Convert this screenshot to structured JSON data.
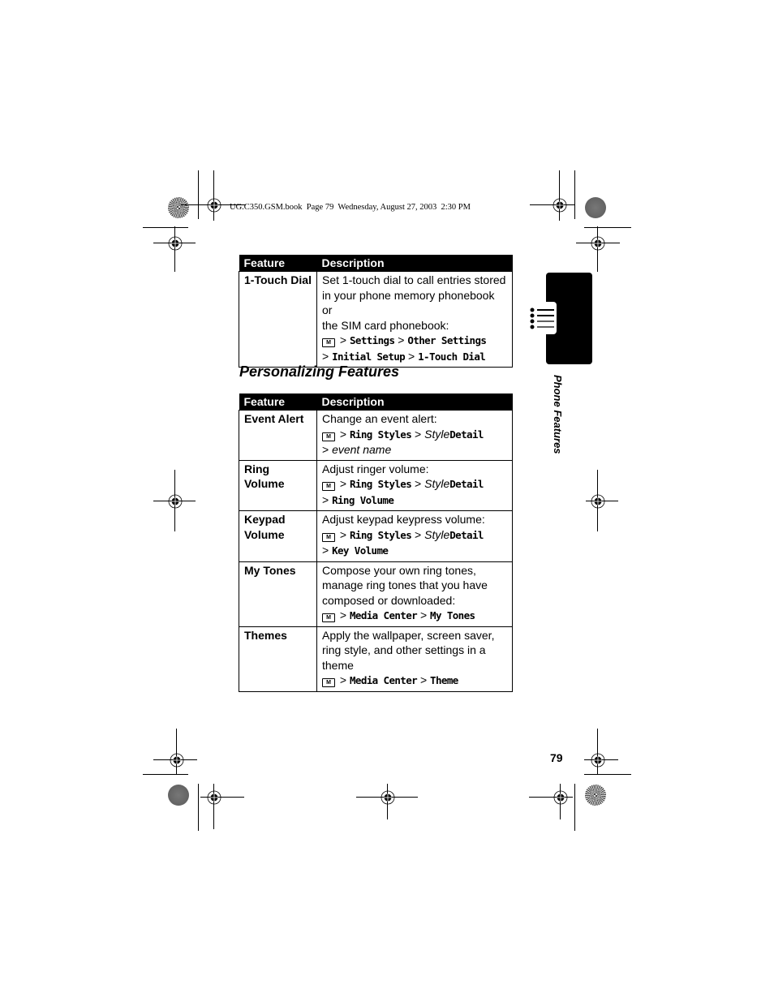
{
  "header": {
    "print_line": "UG.C350.GSM.book  Page 79  Wednesday, August 27, 2003  2:30 PM"
  },
  "side_tab": {
    "label": "Phone Features",
    "icon": "list-bullets-icon"
  },
  "table1": {
    "headers": [
      "Feature",
      "Description"
    ],
    "rows": [
      {
        "feature": "1-Touch Dial",
        "desc_lines": [
          "Set 1-touch dial to call entries stored",
          "in your phone memory phonebook or",
          "the SIM card phonebook:"
        ],
        "path": [
          {
            "text": "Settings",
            "style": "mono"
          },
          {
            "text": "Other Settings",
            "style": "mono"
          },
          {
            "text": "Initial Setup",
            "style": "mono",
            "newline": true
          },
          {
            "text": "1-Touch Dial",
            "style": "mono"
          }
        ]
      }
    ]
  },
  "section": {
    "title": "Personalizing Features"
  },
  "table2": {
    "headers": [
      "Feature",
      "Description"
    ],
    "rows": [
      {
        "feature_lines": [
          "Event Alert"
        ],
        "desc": "Change an event alert:",
        "path_line1": [
          "Ring Styles",
          "Style",
          "Detail"
        ],
        "path_line2": "event name",
        "path_line2_style": "italic"
      },
      {
        "feature_lines": [
          "Ring",
          "Volume"
        ],
        "desc": "Adjust ringer volume:",
        "path_line1": [
          "Ring Styles",
          "Style",
          "Detail"
        ],
        "path_line2": "Ring Volume",
        "path_line2_style": "mono"
      },
      {
        "feature_lines": [
          "Keypad",
          "Volume"
        ],
        "desc": "Adjust keypad keypress volume:",
        "path_line1": [
          "Ring Styles",
          "Style",
          "Detail"
        ],
        "path_line2": "Key Volume",
        "path_line2_style": "mono"
      },
      {
        "feature_lines": [
          "My Tones"
        ],
        "desc_lines": [
          "Compose your own ring tones,",
          "manage ring tones that you have",
          "composed or downloaded:"
        ],
        "path": [
          "Media Center",
          "My Tones"
        ]
      },
      {
        "feature_lines": [
          "Themes"
        ],
        "desc_lines": [
          "Apply the wallpaper, screen saver,",
          "ring style, and other settings in a",
          "theme"
        ],
        "path": [
          "Media Center",
          "Theme"
        ]
      }
    ]
  },
  "menu_key_symbol": "M",
  "separator": ">",
  "footer": {
    "page_number": "79"
  }
}
